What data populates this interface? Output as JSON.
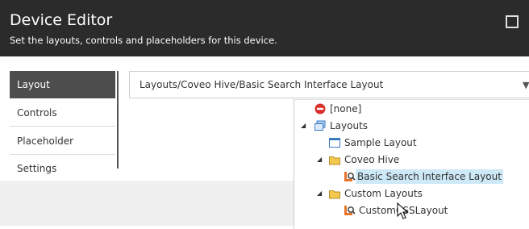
{
  "header": {
    "title": "Device Editor",
    "subtitle": "Set the layouts, controls and placeholders for this device."
  },
  "tabs": [
    {
      "label": "Layout"
    },
    {
      "label": "Controls"
    },
    {
      "label": "Placeholder Settings"
    }
  ],
  "layout_select": {
    "value": "Layouts/Coveo Hive/Basic Search Interface Layout"
  },
  "tree": {
    "items": [
      {
        "label": "[none]",
        "icon": "none-circle-icon"
      },
      {
        "label": "Layouts",
        "icon": "layouts-folder-icon",
        "expander": "expanded"
      },
      {
        "label": "Sample Layout",
        "icon": "layout-page-icon"
      },
      {
        "label": "Coveo Hive",
        "icon": "folder-icon",
        "expander": "expanded"
      },
      {
        "label": "Basic Search Interface Layout",
        "icon": "search-layout-icon",
        "selected": true
      },
      {
        "label": "Custom Layouts",
        "icon": "folder-icon",
        "expander": "expanded"
      },
      {
        "label": "CustomCSSLayout",
        "icon": "search-layout-icon"
      }
    ]
  },
  "colors": {
    "header_bg": "#2b2b2b",
    "active_tab_bg": "#4d4d4d",
    "selection_bg": "#cde8f6",
    "none_icon_red": "#d9302c",
    "folder_yellow": "#f2c94c"
  }
}
